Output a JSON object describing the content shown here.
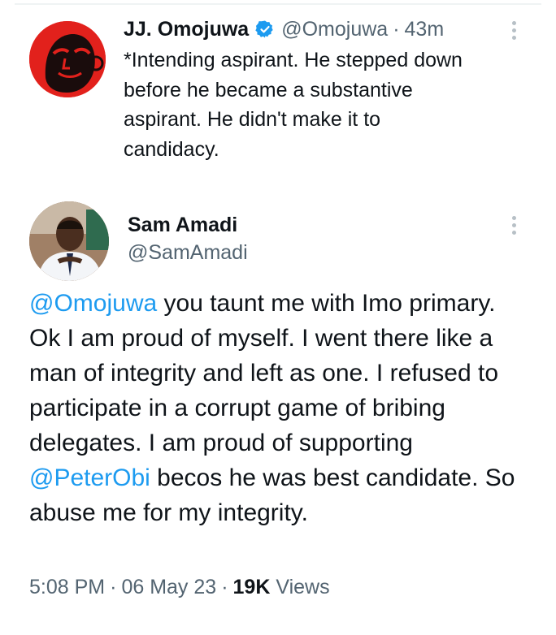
{
  "reply": {
    "author_name": "JJ. Omojuwa",
    "handle": "@Omojuwa",
    "separator": "·",
    "time": "43m",
    "text": "*Intending aspirant. He stepped down\nbefore he became a substantive\naspirant. He didn't make it to\ncandidacy."
  },
  "tweet": {
    "author_name": "Sam Amadi",
    "handle": "@SamAmadi",
    "text_parts": {
      "p1_mention": "@Omojuwa",
      "p2": " you taunt me with Imo primary. Ok I am proud of myself. I went there like a man of integrity and left as one. I refused to participate in a corrupt game of bribing delegates. I am proud of supporting ",
      "p3_mention": "@PeterObi",
      "p4": " becos he was best candidate. So abuse me for my integrity."
    },
    "meta": {
      "time": "5:08 PM",
      "sep1": "·",
      "date": "06 May 23",
      "sep2": "·",
      "views_count": "19K",
      "views_label": "Views"
    }
  },
  "colors": {
    "link": "#1d9bf0",
    "verified": "#1d9bf0",
    "secondary_text": "#536471",
    "primary_text": "#0f1419"
  },
  "icons": {
    "verified": "verified-badge-icon",
    "more": "more-vertical-icon"
  }
}
